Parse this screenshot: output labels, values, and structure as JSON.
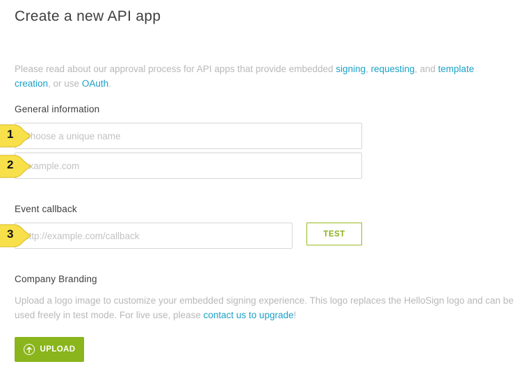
{
  "page": {
    "title": "Create a new API app"
  },
  "intro": {
    "text_1": "Please read about our approval process for API apps that provide embedded ",
    "link_signing": "signing",
    "sep_1": ", ",
    "link_requesting": "requesting",
    "text_2": ", and ",
    "link_template_creation": "template creation",
    "text_3": ", or use ",
    "link_oauth": "OAuth",
    "text_4": "."
  },
  "general": {
    "label": "General information",
    "name_placeholder": "Choose a unique name",
    "domain_placeholder": "example.com"
  },
  "callback": {
    "label": "Event callback",
    "url_placeholder": "http://example.com/callback",
    "test_label": "TEST"
  },
  "branding": {
    "label": "Company Branding",
    "text_1": "Upload a logo image to customize your embedded signing experience. This logo replaces the HelloSign logo and can be used freely in test mode. For live use, please ",
    "link_contact": "contact us to upgrade",
    "text_2": "!",
    "upload_label": "UPLOAD"
  },
  "callouts": [
    "1",
    "2",
    "3"
  ],
  "colors": {
    "link": "#1aa0c8",
    "accent_green": "#8ab51c",
    "callout_yellow": "#f7e04a"
  },
  "icons": {
    "upload": "arrow-up-circle-icon"
  }
}
